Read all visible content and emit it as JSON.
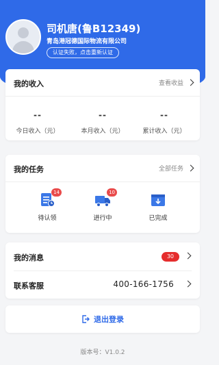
{
  "profile": {
    "name": "司机唐(鲁B12349)",
    "company": "青岛港冠德国际物流有限公司",
    "auth_status": "认证失败，点击重新认证"
  },
  "income": {
    "title": "我的收入",
    "link": "查看收益",
    "stats": [
      {
        "value": "--",
        "label": "今日收入（元）"
      },
      {
        "value": "--",
        "label": "本月收入（元）"
      },
      {
        "value": "--",
        "label": "累计收入（元）"
      }
    ]
  },
  "tasks": {
    "title": "我的任务",
    "link": "全部任务",
    "items": [
      {
        "label": "待认领",
        "badge": "14",
        "icon": "clipboard-icon"
      },
      {
        "label": "进行中",
        "badge": "10",
        "icon": "truck-icon"
      },
      {
        "label": "已完成",
        "badge": "",
        "icon": "box-icon"
      }
    ]
  },
  "messages": {
    "title": "我的消息",
    "count": "30"
  },
  "support": {
    "title": "联系客服",
    "phone": "400-166-1756"
  },
  "logout": {
    "label": "退出登录"
  },
  "version": "版本号：V1.0.2",
  "colors": {
    "primary": "#2f6ae8",
    "badge_red": "#e94b4b",
    "background": "#f4f5f7"
  }
}
